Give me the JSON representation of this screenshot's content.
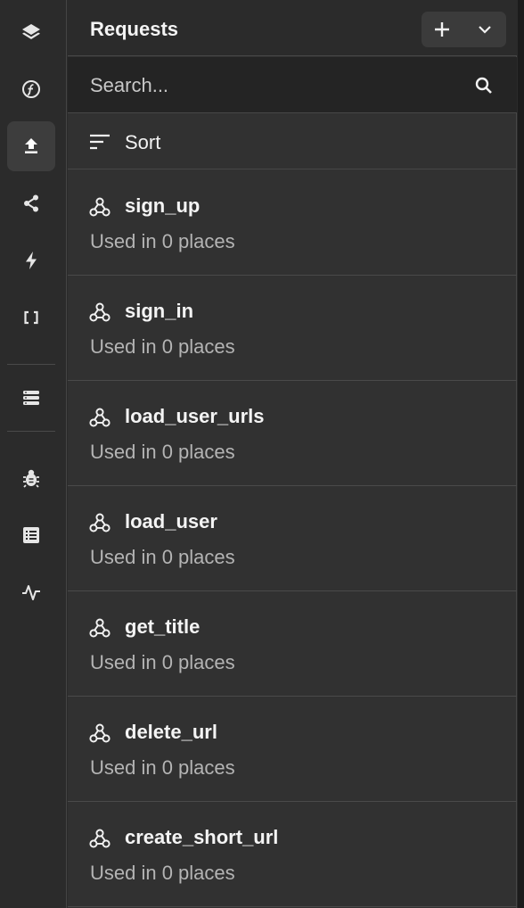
{
  "rail": {
    "items": [
      {
        "icon": "layers-icon"
      },
      {
        "icon": "function-icon"
      },
      {
        "icon": "upload-icon",
        "active": true
      },
      {
        "icon": "share-icon"
      },
      {
        "icon": "lightning-icon"
      },
      {
        "icon": "brackets-icon"
      },
      {
        "icon": "database-icon"
      },
      {
        "icon": "bug-icon"
      },
      {
        "icon": "list-icon"
      },
      {
        "icon": "activity-icon"
      }
    ]
  },
  "panel": {
    "title": "Requests",
    "search_placeholder": "Search...",
    "sort_label": "Sort"
  },
  "requests": [
    {
      "name": "sign_up",
      "usage": "Used in 0 places"
    },
    {
      "name": "sign_in",
      "usage": "Used in 0 places"
    },
    {
      "name": "load_user_urls",
      "usage": "Used in 0 places"
    },
    {
      "name": "load_user",
      "usage": "Used in 0 places"
    },
    {
      "name": "get_title",
      "usage": "Used in 0 places"
    },
    {
      "name": "delete_url",
      "usage": "Used in 0 places"
    },
    {
      "name": "create_short_url",
      "usage": "Used in 0 places"
    }
  ],
  "colors": {
    "background": "#2b2b2b",
    "panel": "#313131",
    "search_bg": "#242424",
    "text": "#f2f2f2",
    "muted_text": "#b4b4b4"
  }
}
